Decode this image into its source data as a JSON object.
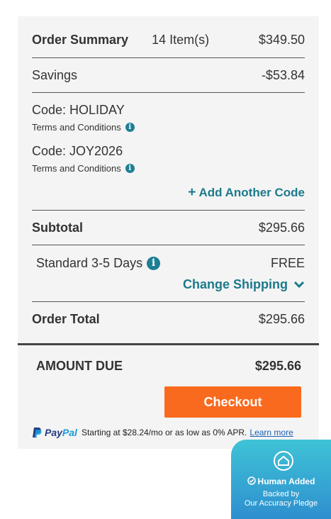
{
  "summary": {
    "title": "Order Summary",
    "items": "14 Item(s)",
    "total_before": "$349.50",
    "savings_label": "Savings",
    "savings_value": "-$53.84",
    "codes": [
      {
        "label": "Code: HOLIDAY",
        "terms": "Terms and Conditions"
      },
      {
        "label": "Code: JOY2026",
        "terms": "Terms and Conditions"
      }
    ],
    "add_code": "Add Another Code",
    "subtotal_label": "Subtotal",
    "subtotal_value": "$295.66",
    "shipping_label": "Standard 3-5 Days",
    "shipping_value": "FREE",
    "change_shipping": "Change Shipping",
    "order_total_label": "Order Total",
    "order_total_value": "$295.66",
    "amount_due_label": "AMOUNT DUE",
    "amount_due_value": "$295.66",
    "checkout": "Checkout"
  },
  "paypal": {
    "logo_a": "Pay",
    "logo_b": "Pal",
    "text": "Starting at $28.24/mo or as low as 0% APR.",
    "link": "Learn more"
  },
  "badge": {
    "title": "Human Added",
    "line1": "Backed by",
    "line2": "Our Accuracy Pledge"
  },
  "colors": {
    "accent": "#1b7a8c",
    "checkout": "#fa6a1e",
    "panel": "#f4f4f4"
  }
}
